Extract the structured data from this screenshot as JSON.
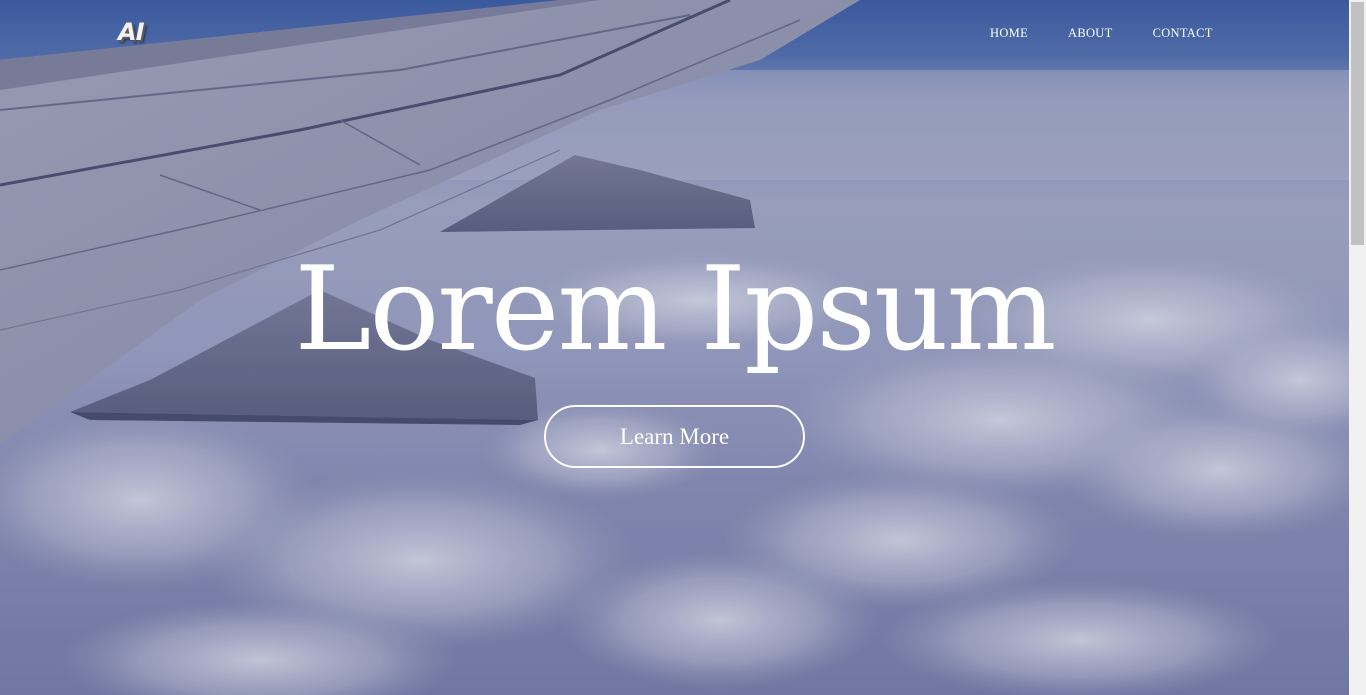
{
  "logo": {
    "text": "AI"
  },
  "nav": {
    "items": [
      {
        "label": "HOME"
      },
      {
        "label": "ABOUT"
      },
      {
        "label": "CONTACT"
      }
    ]
  },
  "hero": {
    "title": "Lorem Ipsum",
    "cta_label": "Learn More",
    "background_image": "airplane wing above clouds"
  },
  "colors": {
    "text": "#ffffff",
    "sky_top": "#3d5fa6",
    "clouds": "#a7acc8",
    "scrollbar_track": "#f1f1f1",
    "scrollbar_thumb": "#c1c1c1"
  }
}
